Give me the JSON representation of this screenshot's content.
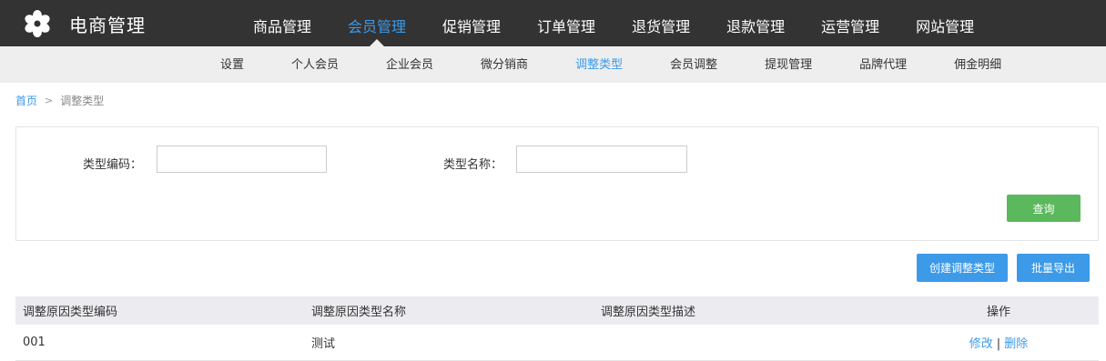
{
  "app": {
    "title": "电商管理",
    "logo_icon": "flower-gear-icon"
  },
  "main_nav": {
    "items": [
      {
        "label": "商品管理",
        "active": false
      },
      {
        "label": "会员管理",
        "active": true
      },
      {
        "label": "促销管理",
        "active": false
      },
      {
        "label": "订单管理",
        "active": false
      },
      {
        "label": "退货管理",
        "active": false
      },
      {
        "label": "退款管理",
        "active": false
      },
      {
        "label": "运营管理",
        "active": false
      },
      {
        "label": "网站管理",
        "active": false
      }
    ]
  },
  "sub_nav": {
    "items": [
      {
        "label": "设置",
        "active": false
      },
      {
        "label": "个人会员",
        "active": false
      },
      {
        "label": "企业会员",
        "active": false
      },
      {
        "label": "微分销商",
        "active": false
      },
      {
        "label": "调整类型",
        "active": true
      },
      {
        "label": "会员调整",
        "active": false
      },
      {
        "label": "提现管理",
        "active": false
      },
      {
        "label": "品牌代理",
        "active": false
      },
      {
        "label": "佣金明细",
        "active": false
      }
    ]
  },
  "breadcrumb": {
    "home": "首页",
    "separator": ">",
    "current": "调整类型"
  },
  "search": {
    "type_code_label": "类型编码：",
    "type_code_value": "",
    "type_name_label": "类型名称：",
    "type_name_value": "",
    "query_button": "查询"
  },
  "actions": {
    "create_button": "创建调整类型",
    "export_button": "批量导出"
  },
  "table": {
    "headers": [
      "调整原因类型编码",
      "调整原因类型名称",
      "调整原因类型描述",
      "操作"
    ],
    "rows": [
      {
        "code": "001",
        "name": "测试",
        "description": "",
        "edit": "修改",
        "op_separator": "|",
        "delete": "删除"
      }
    ]
  },
  "colors": {
    "topbar": "#333333",
    "subbar": "#eeeeee",
    "accent": "#3c9ae8",
    "query_button": "#5cb85c"
  }
}
